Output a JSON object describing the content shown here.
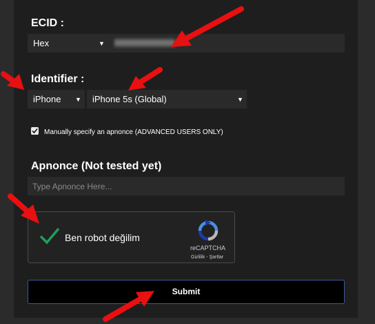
{
  "ecid": {
    "label": "ECID :",
    "format_selected": "Hex"
  },
  "identifier": {
    "label": "Identifier :",
    "device_selected": "iPhone",
    "model_selected": "iPhone 5s (Global)"
  },
  "manual_apnonce": {
    "checked": true,
    "label": "Manually specify an apnonce (ADVANCED USERS ONLY)"
  },
  "apnonce": {
    "label": "Apnonce (Not tested yet)",
    "placeholder": "Type Apnonce Here..."
  },
  "captcha": {
    "checked": true,
    "label": "Ben robot değilim",
    "brand": "reCAPTCHA",
    "links": "Gizlilik - Şartlar"
  },
  "submit_label": "Submit",
  "colors": {
    "annotation_arrow": "#e81010",
    "captcha_check": "#1e9e5a",
    "submit_border": "#3f5b99"
  },
  "icons": [
    "caret-down-icon",
    "checkmark-icon",
    "recaptcha-logo-icon",
    "red-arrow-icon"
  ]
}
